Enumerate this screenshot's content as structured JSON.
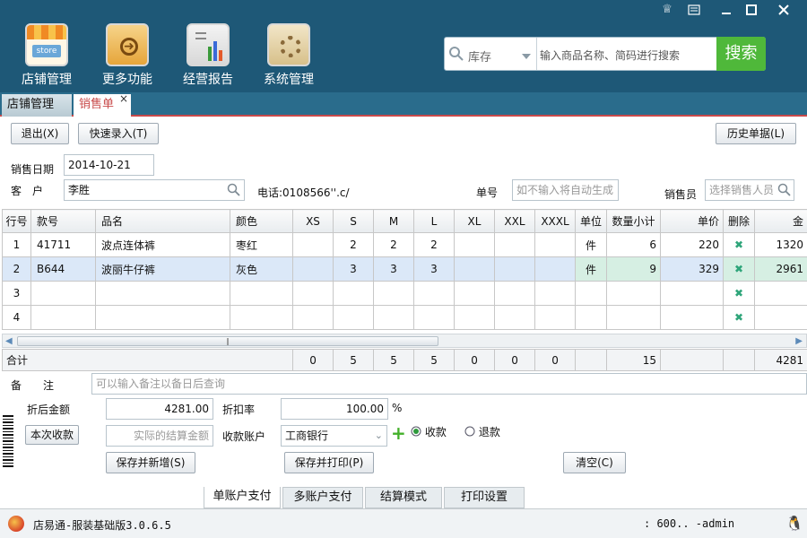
{
  "window": {
    "shirt_icon": "shirt-icon",
    "menu_icon": "menu-icon",
    "minimize": "minimize-icon",
    "maximize": "maximize-icon",
    "close": "close-icon"
  },
  "nav": [
    {
      "label": "店铺管理",
      "icon": "store-icon"
    },
    {
      "label": "更多功能",
      "icon": "tools-icon"
    },
    {
      "label": "经营报告",
      "icon": "report-icon"
    },
    {
      "label": "系统管理",
      "icon": "settings-icon"
    }
  ],
  "search": {
    "category": "库存",
    "placeholder": "输入商品名称、简码进行搜索",
    "button": "搜索"
  },
  "tabs": [
    {
      "label": "店铺管理"
    },
    {
      "label": "销售单",
      "close": "×"
    }
  ],
  "toolbar": {
    "exit": "退出(X)",
    "quick": "快速录入(T)",
    "history": "历史单据(L)"
  },
  "form": {
    "date_label": "销售日期",
    "date": "2014-10-21",
    "customer_label": "客　户",
    "customer": "李胜",
    "phone": "电话:0108566''.c/",
    "order_label": "单号",
    "order_placeholder": "如不输入将自动生成",
    "seller_label": "销售员",
    "seller_placeholder": "选择销售人员"
  },
  "table": {
    "headers": [
      "行号",
      "款号",
      "品名",
      "颜色",
      "XS",
      "S",
      "M",
      "L",
      "XL",
      "XXL",
      "XXXL",
      "单位",
      "数量小计",
      "单价",
      "删除",
      "金"
    ],
    "rows": [
      {
        "no": "1",
        "code": "41711",
        "name": "波点连体裤",
        "color": "枣红",
        "xs": "",
        "s": "2",
        "m": "2",
        "l": "2",
        "xl": "",
        "xxl": "",
        "xxxl": "",
        "unit": "件",
        "qty": "6",
        "price": "220",
        "amount": "1320"
      },
      {
        "no": "2",
        "code": "B644",
        "name": "波丽牛仔裤",
        "color": "灰色",
        "xs": "",
        "s": "3",
        "m": "3",
        "l": "3",
        "xl": "",
        "xxl": "",
        "xxxl": "",
        "unit": "件",
        "qty": "9",
        "price": "329",
        "amount": "2961"
      },
      {
        "no": "3",
        "code": "",
        "name": "",
        "color": "",
        "xs": "",
        "s": "",
        "m": "",
        "l": "",
        "xl": "",
        "xxl": "",
        "xxxl": "",
        "unit": "",
        "qty": "",
        "price": "",
        "amount": ""
      },
      {
        "no": "4",
        "code": "",
        "name": "",
        "color": "",
        "xs": "",
        "s": "",
        "m": "",
        "l": "",
        "xl": "",
        "xxl": "",
        "xxxl": "",
        "unit": "",
        "qty": "",
        "price": "",
        "amount": ""
      }
    ]
  },
  "totals": {
    "label": "合计",
    "xs": "0",
    "s": "5",
    "m": "5",
    "l": "5",
    "xl": "0",
    "xxl": "0",
    "xxxl": "0",
    "qty": "15",
    "amount": "4281"
  },
  "remark": {
    "label": "备　　注",
    "placeholder": "可以输入备注以备日后查询"
  },
  "pay": {
    "after_label": "折后金额",
    "after": "4281.00",
    "rate_label": "折扣率",
    "rate": "100.00",
    "pct": "%",
    "receive_btn": "本次收款",
    "actual_placeholder": "实际的结算金额",
    "account_label": "收款账户",
    "account": "工商银行",
    "opt_receive": "收款",
    "opt_refund": "退款"
  },
  "actions": {
    "save_new": "保存并新增(S)",
    "save_print": "保存并打印(P)",
    "clear": "清空(C)"
  },
  "bottom_tabs": [
    "单账户支付",
    "多账户支付",
    "结算模式",
    "打印设置"
  ],
  "status": {
    "app": "店易通-服装基础版3.0.6.5",
    "user": ": 600.. -admin"
  }
}
